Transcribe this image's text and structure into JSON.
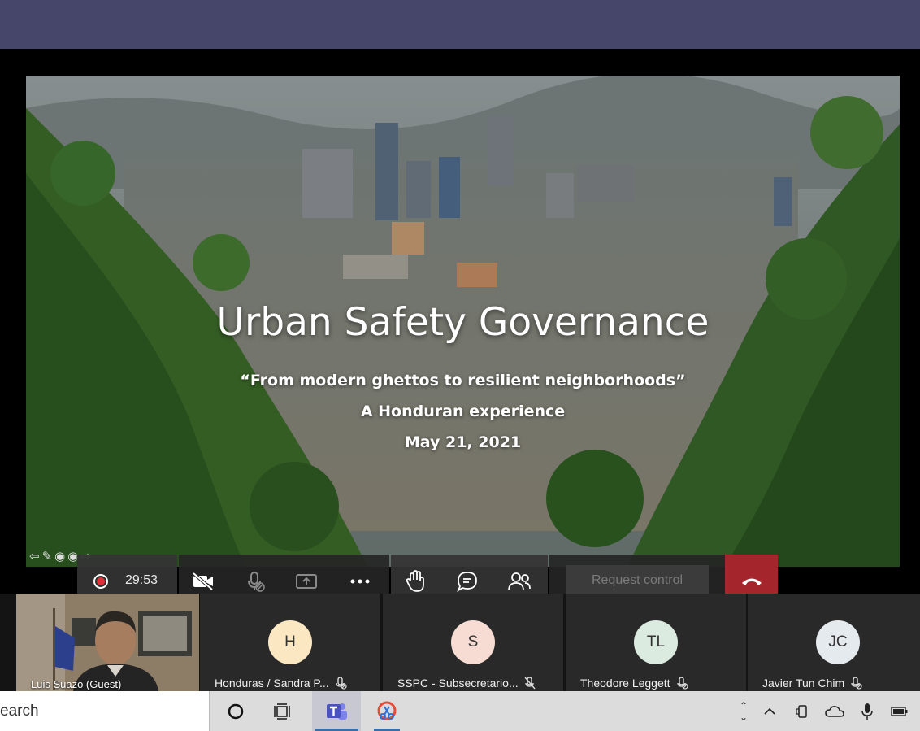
{
  "slide": {
    "title": "Urban Safety Governance",
    "subtitle": "“From modern ghettos to resilient neighborhoods”",
    "line2": "A Honduran experience",
    "date": "May 21, 2021"
  },
  "callbar": {
    "timer": "29:53",
    "request_control_label": "Request control"
  },
  "participants": [
    {
      "name": "Luis Suazo (Guest)",
      "video": true
    },
    {
      "name": "Honduras / Sandra P...",
      "initials": "H",
      "avatar_color": "#fbe8c2"
    },
    {
      "name": "SSPC - Subsecretario...",
      "initials": "S",
      "avatar_color": "#f6dcd2"
    },
    {
      "name": "Theodore Leggett",
      "initials": "TL",
      "avatar_color": "#dcebe0"
    },
    {
      "name": "Javier Tun Chim",
      "initials": "JC",
      "avatar_color": "#e5eaef"
    }
  ],
  "taskbar": {
    "search_text": "earch"
  },
  "colors": {
    "title_bar": "#46466b",
    "hangup": "#a4262c",
    "record": "#e0313a"
  }
}
